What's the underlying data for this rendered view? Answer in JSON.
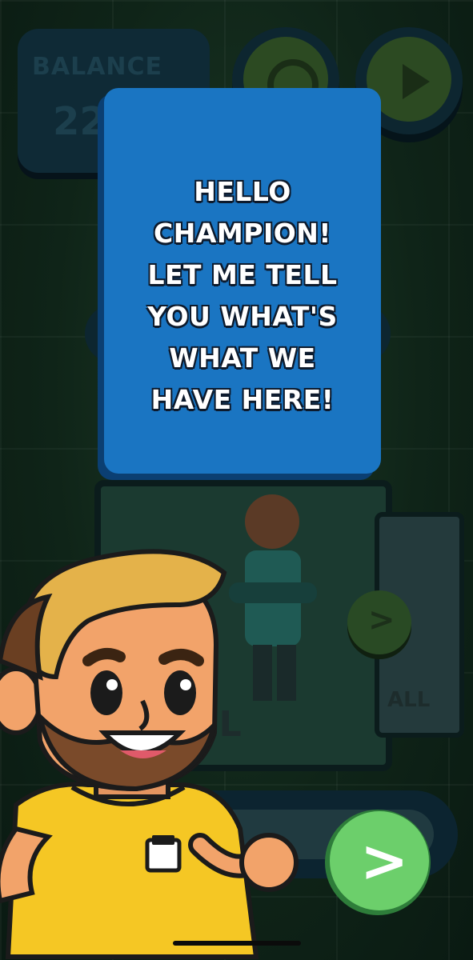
{
  "background": {
    "balance_label": "BALANCE",
    "balance_value": "22",
    "card_title": "TBALL",
    "card_right_title": "ALL",
    "small_next_symbol": ">"
  },
  "dialog": {
    "lines": [
      "HELLO",
      "CHAMPION!",
      "LET ME TELL",
      "YOU WHAT'S",
      "WHAT WE",
      "HAVE HERE!"
    ]
  },
  "next_button": {
    "symbol": ">"
  },
  "colors": {
    "dialog_bg": "#1a75c2",
    "next_button": "#6ccf6b",
    "mascot_shirt": "#f5c724"
  },
  "icons": {
    "settings": "gear-icon",
    "play": "play-icon"
  }
}
